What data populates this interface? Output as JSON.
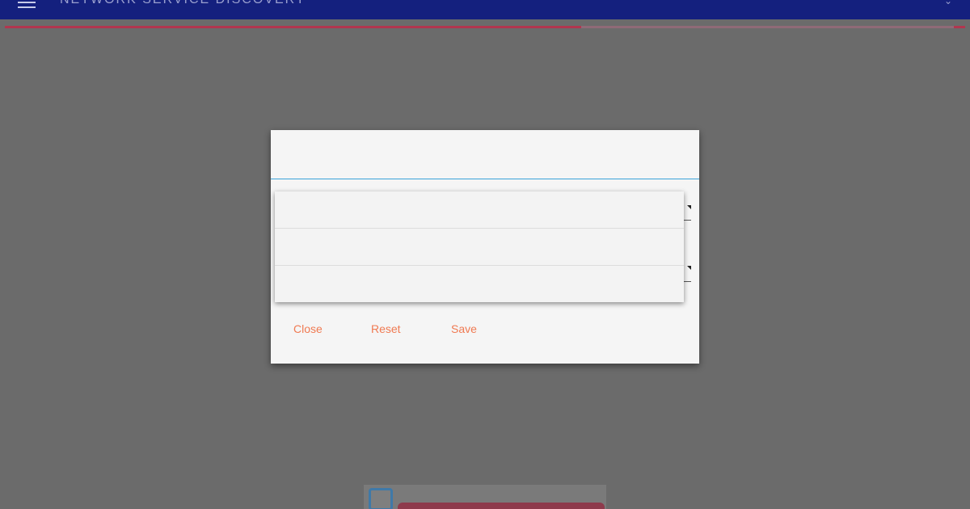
{
  "appbar": {
    "title": "NETWORK SERVICE DISCOVERY",
    "menu_icon": "hamburger-menu-icon",
    "overflow_icon": "chevron-down-icon",
    "background": "#14207e"
  },
  "progress": {
    "fraction": 0.6,
    "color": "#b2364f"
  },
  "dialog": {
    "title": "",
    "accent": "#3aa3d9",
    "dropdown_options": [
      "",
      "",
      ""
    ],
    "actions": {
      "close_label": "Close",
      "reset_label": "Reset",
      "save_label": "Save",
      "color": "#f07a52"
    }
  }
}
